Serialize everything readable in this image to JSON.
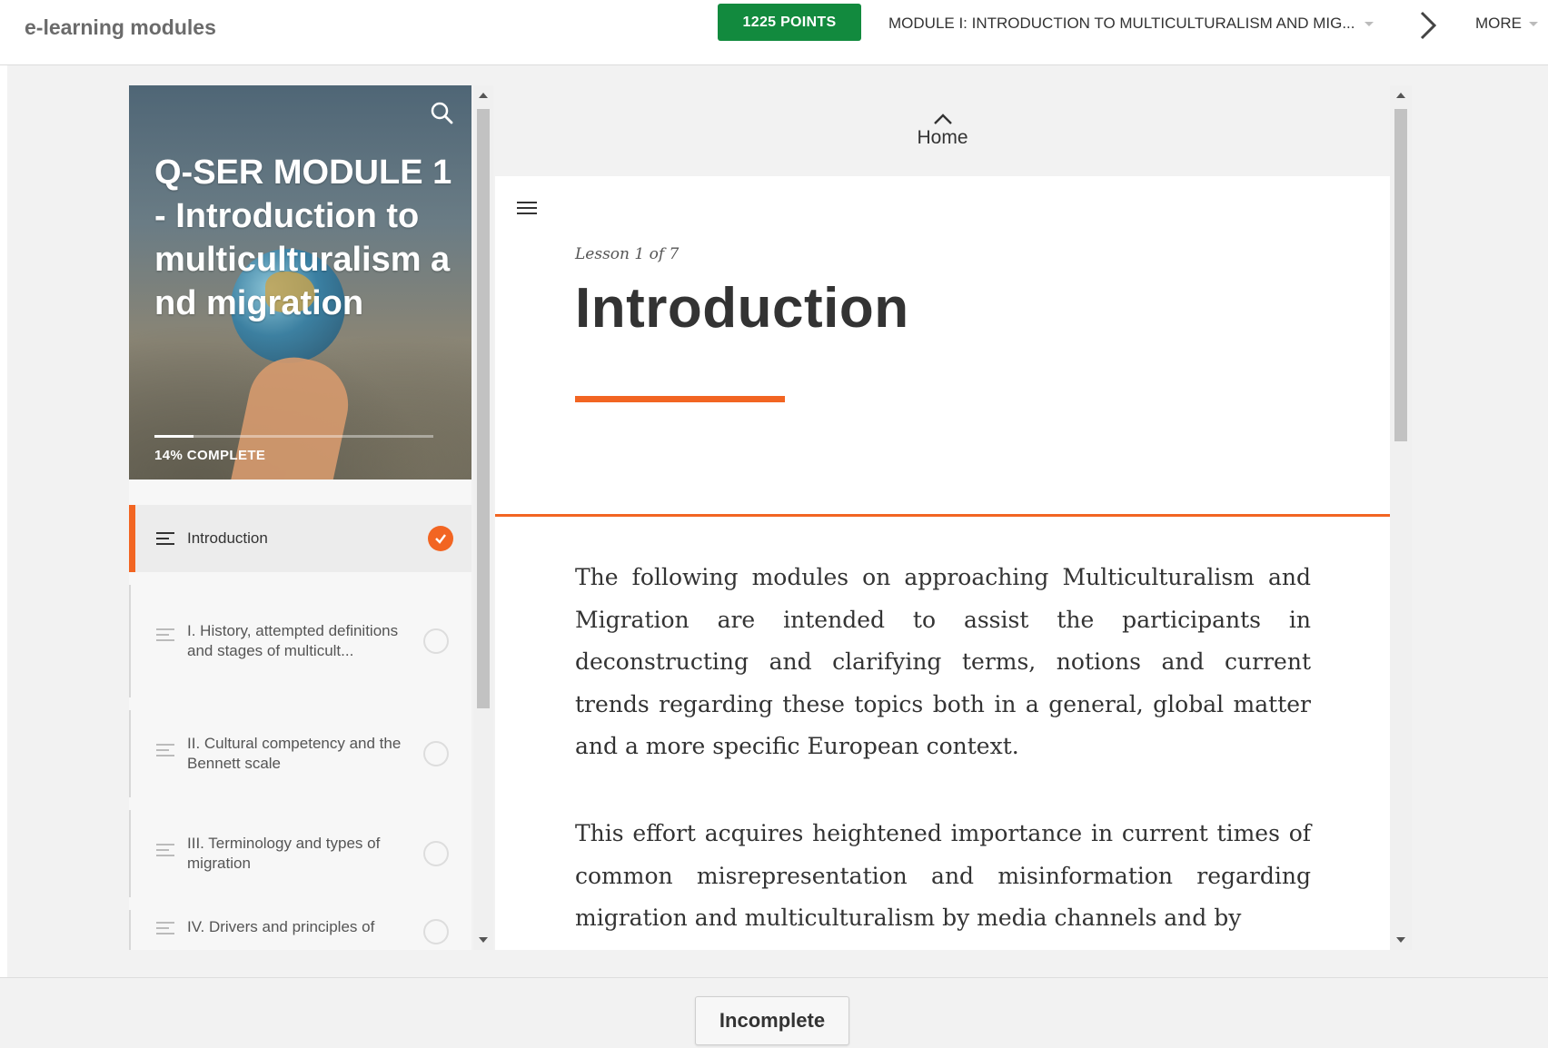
{
  "header": {
    "app_title": "e-learning modules",
    "points": "1225 POINTS",
    "module_select": "MODULE I: INTRODUCTION TO MULTICULTURALISM AND MIG...",
    "more_label": "MORE"
  },
  "sidebar": {
    "course_title": "Q-SER MODULE 1- Introduction to multiculturalism and migration",
    "progress_label": "14% COMPLETE",
    "progress_fraction": 0.14,
    "lessons": [
      {
        "label": "Introduction",
        "status": "complete",
        "active": true
      },
      {
        "label": "I. History, attempted definitions and stages of multicult...",
        "status": "incomplete",
        "active": false
      },
      {
        "label": "II. Cultural competency and the Bennett scale",
        "status": "incomplete",
        "active": false
      },
      {
        "label": "III. Terminology and types of migration",
        "status": "incomplete",
        "active": false
      },
      {
        "label": "IV. Drivers and principles of",
        "status": "incomplete",
        "active": false
      }
    ]
  },
  "content": {
    "home_label": "Home",
    "lesson_count": "Lesson 1 of 7",
    "lesson_title": "Introduction",
    "paragraphs": [
      "The following modules on approaching Multiculturalism and Migration are intended to assist the participants in deconstructing and clarifying terms, notions and current trends regarding these topics both in a general, global matter and a more specific European context.",
      "This effort acquires heightened importance in current times of common misrepresentation and misinformation regarding migration and multiculturalism by media channels and by"
    ]
  },
  "footer": {
    "status_button": "Incomplete"
  },
  "colors": {
    "accent": "#f26522",
    "points_bg": "#128a3e"
  }
}
